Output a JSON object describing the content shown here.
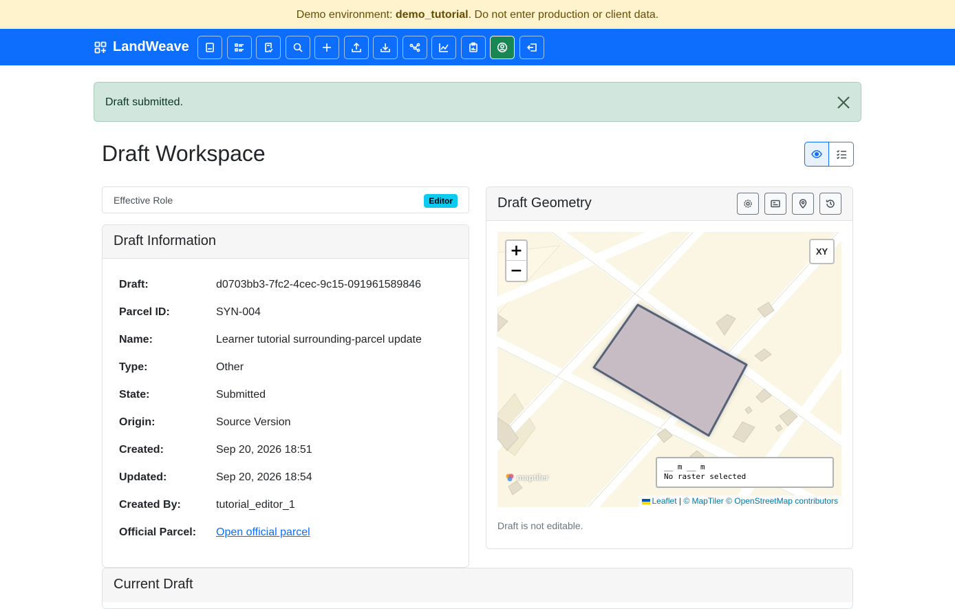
{
  "banner": {
    "prefix": "Demo environment: ",
    "env": "demo_tutorial",
    "suffix": ". Do not enter production or client data."
  },
  "navbar": {
    "brand": "LandWeave",
    "buttons": [
      {
        "name": "book-icon"
      },
      {
        "name": "list-icon"
      },
      {
        "name": "drafts-icon"
      },
      {
        "name": "search-icon"
      },
      {
        "name": "plus-icon"
      },
      {
        "name": "upload-icon"
      },
      {
        "name": "download-icon"
      },
      {
        "name": "network-icon"
      },
      {
        "name": "chart-icon"
      },
      {
        "name": "clipboard-icon"
      },
      {
        "name": "user-circle-icon",
        "active": true
      },
      {
        "name": "logout-icon"
      }
    ]
  },
  "alert": {
    "message": "Draft submitted."
  },
  "page": {
    "title": "Draft Workspace"
  },
  "role": {
    "label": "Effective Role",
    "badge": "Editor"
  },
  "info": {
    "title": "Draft Information",
    "rows": [
      {
        "key": "Draft:",
        "value": "d0703bb3-7fc2-4cec-9c15-091961589846"
      },
      {
        "key": "Parcel ID:",
        "value": "SYN-004"
      },
      {
        "key": "Name:",
        "value": "Learner tutorial surrounding-parcel update"
      },
      {
        "key": "Type:",
        "value": "Other"
      },
      {
        "key": "State:",
        "value": "Submitted"
      },
      {
        "key": "Origin:",
        "value": "Source Version"
      },
      {
        "key": "Created:",
        "value": "Sep 20, 2026 18:51"
      },
      {
        "key": "Updated:",
        "value": "Sep 20, 2026 18:54"
      },
      {
        "key": "Created By:",
        "value": "tutorial_editor_1"
      }
    ],
    "official": {
      "key": "Official Parcel:",
      "link": "Open official parcel"
    }
  },
  "geometry": {
    "title": "Draft Geometry",
    "map": {
      "zoom_in": "+",
      "zoom_out": "−",
      "xy_label": "XY",
      "scale_text": "__ m __ m",
      "raster_text": "No raster selected",
      "logo_text": "maptiler",
      "attribution": {
        "leaflet": "Leaflet",
        "sep": " | ",
        "maptiler": "© MapTiler",
        "osm": "© OpenStreetMap contributors"
      }
    },
    "note": "Draft is not editable."
  },
  "current": {
    "title": "Current Draft"
  },
  "colors": {
    "banner_bg": "#fff3cd",
    "navbar": "#0d6efd",
    "alert_bg": "#d1e7dd",
    "badge": "#0dcaf0",
    "active_nav": "#198754",
    "parcel_fill": "#c8bcc4",
    "parcel_stroke": "#556277"
  }
}
